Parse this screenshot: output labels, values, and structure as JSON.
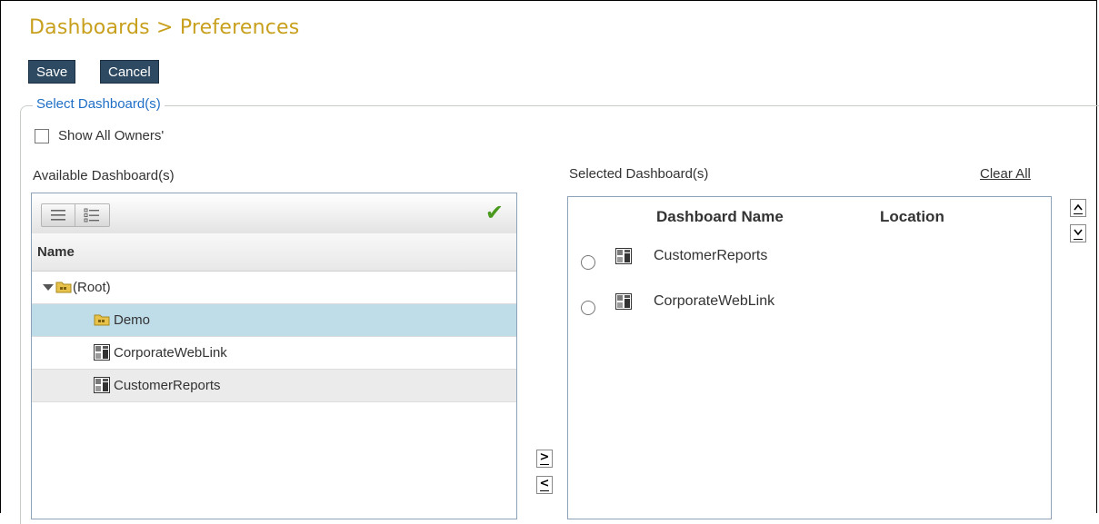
{
  "page": {
    "breadcrumb": "Dashboards > Preferences"
  },
  "toolbar": {
    "save_label": "Save",
    "cancel_label": "Cancel"
  },
  "select_section": {
    "legend": "Select Dashboard(s)",
    "show_all_owners_label": "Show All Owners'",
    "show_all_owners_checked": false
  },
  "available": {
    "title": "Available Dashboard(s)",
    "column_name": "Name",
    "tree": [
      {
        "label": "(Root)",
        "type": "folder",
        "expanded": true,
        "level": 0
      },
      {
        "label": "Demo",
        "type": "folder",
        "selected": true,
        "level": 1
      },
      {
        "label": "CorporateWebLink",
        "type": "dashboard",
        "level": 1
      },
      {
        "label": "CustomerReports",
        "type": "dashboard",
        "level": 1
      }
    ]
  },
  "selected": {
    "title": "Selected Dashboard(s)",
    "clear_all": "Clear All",
    "columns": [
      "Dashboard Name",
      "Location"
    ],
    "rows": [
      {
        "name": "CustomerReports",
        "location": ""
      },
      {
        "name": "CorporateWebLink",
        "location": ""
      }
    ]
  },
  "controls": {
    "move_right": ">",
    "move_left": "<",
    "move_up": "^",
    "move_down": "v"
  },
  "colors": {
    "title": "#c8a01e",
    "button_bg": "#2e4a62",
    "legend": "#1f6fc6",
    "selected_row": "#bfdce9",
    "check": "#4a9a20"
  }
}
